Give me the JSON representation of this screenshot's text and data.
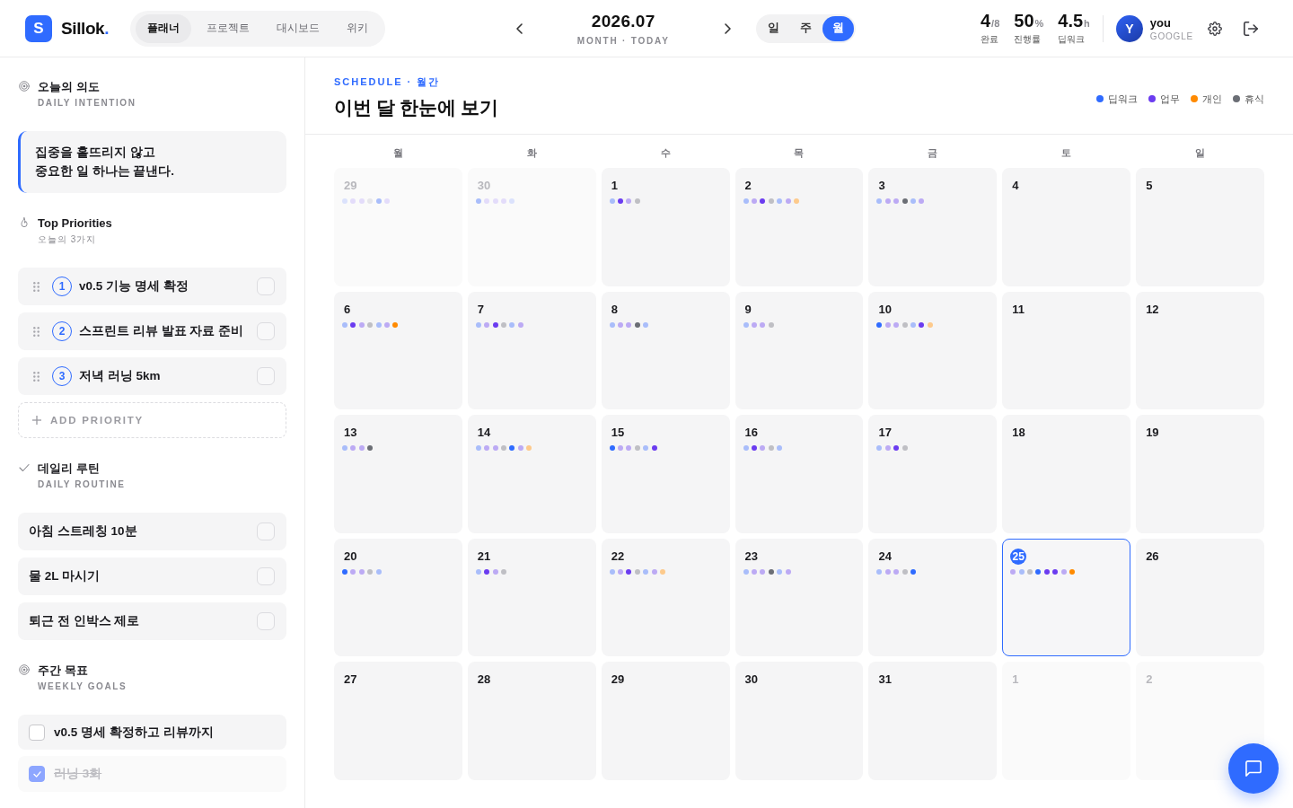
{
  "header": {
    "logo": {
      "letter": "S",
      "name": "Sillok",
      "suffix": "."
    },
    "nav_tabs": [
      {
        "label": "플래너",
        "selected": true
      },
      {
        "label": "프로젝트",
        "selected": false
      },
      {
        "label": "대시보드",
        "selected": false
      },
      {
        "label": "위키",
        "selected": false
      }
    ],
    "period": {
      "title": "2026.07",
      "subtitle": "MONTH · TODAY"
    },
    "view_modes": [
      {
        "label": "일",
        "selected": false
      },
      {
        "label": "주",
        "selected": false
      },
      {
        "label": "월",
        "selected": true
      }
    ],
    "stats": [
      {
        "value": "4",
        "unit": "/8",
        "label": "완료"
      },
      {
        "value": "50",
        "unit": "%",
        "label": "진행률"
      },
      {
        "value": "4.5",
        "unit": "h",
        "label": "딥워크"
      }
    ],
    "user": {
      "initial": "Y",
      "name": "you",
      "provider": "GOOGLE"
    }
  },
  "sidebar": {
    "intention": {
      "title": "오늘의 의도",
      "subtitle": "DAILY INTENTION",
      "text": "집중을 흩뜨리지 않고\n중요한 일 하나는 끝낸다."
    },
    "priorities": {
      "title": "Top Priorities",
      "subtitle": "오늘의 3가지",
      "items": [
        {
          "number": "1",
          "label": "v0.5 기능 명세 확정",
          "checked": false
        },
        {
          "number": "2",
          "label": "스프린트 리뷰 발표 자료 준비",
          "checked": false
        },
        {
          "number": "3",
          "label": "저녁 러닝 5km",
          "checked": false
        }
      ],
      "add_label": "ADD PRIORITY"
    },
    "routine": {
      "title": "데일리 루틴",
      "subtitle": "DAILY ROUTINE",
      "items": [
        {
          "label": "아침 스트레칭 10분",
          "checked": false
        },
        {
          "label": "물 2L 마시기",
          "checked": false
        },
        {
          "label": "퇴근 전 인박스 제로",
          "checked": false
        }
      ]
    },
    "weekly_goals": {
      "title": "주간 목표",
      "subtitle": "WEEKLY GOALS",
      "items": [
        {
          "label": "v0.5 명세 확정하고 리뷰까지",
          "checked": false
        },
        {
          "label": "러닝 3회",
          "checked": true
        }
      ]
    }
  },
  "main": {
    "eyebrow": "SCHEDULE · 월간",
    "title": "이번 달 한눈에 보기",
    "legend": [
      {
        "label": "딥워크",
        "color": "#2f6bff"
      },
      {
        "label": "업무",
        "color": "#6b3cf0"
      },
      {
        "label": "개인",
        "color": "#ff8a00"
      },
      {
        "label": "휴식",
        "color": "#6b6e75"
      }
    ],
    "calendar": {
      "weekdays": [
        "월",
        "화",
        "수",
        "목",
        "금",
        "토",
        "일"
      ],
      "weeks": [
        [
          {
            "date": "29",
            "outside_month": true,
            "today": false,
            "dots": [
              {
                "color": "#dbe2fc"
              },
              {
                "color": "#e3dcfa"
              },
              {
                "color": "#e3dcfa"
              },
              {
                "color": "#e6e6ea"
              },
              {
                "color": "#a9bdfa"
              },
              {
                "color": "#e3dcfa"
              }
            ]
          },
          {
            "date": "30",
            "outside_month": true,
            "today": false,
            "dots": [
              {
                "color": "#a9bdfa"
              },
              {
                "color": "#e3dcfa"
              },
              {
                "color": "#e3dcfa"
              },
              {
                "color": "#e3dcfa"
              },
              {
                "color": "#dbe2fc"
              }
            ]
          },
          {
            "date": "1",
            "outside_month": false,
            "today": false,
            "dots": [
              {
                "color": "#a9bdfa"
              },
              {
                "color": "#6b3cf0"
              },
              {
                "color": "#bcaaf4"
              },
              {
                "color": "#bfbfc4"
              }
            ]
          },
          {
            "date": "2",
            "outside_month": false,
            "today": false,
            "dots": [
              {
                "color": "#a9bdfa"
              },
              {
                "color": "#bcaaf4"
              },
              {
                "color": "#6b3cf0"
              },
              {
                "color": "#bfbfc4"
              },
              {
                "color": "#a9bdfa"
              },
              {
                "color": "#bcaaf4"
              },
              {
                "color": "#fdca8c"
              }
            ]
          },
          {
            "date": "3",
            "outside_month": false,
            "today": false,
            "dots": [
              {
                "color": "#a9bdfa"
              },
              {
                "color": "#bcaaf4"
              },
              {
                "color": "#bcaaf4"
              },
              {
                "color": "#6b6e75"
              },
              {
                "color": "#a9bdfa"
              },
              {
                "color": "#bcaaf4"
              }
            ]
          },
          {
            "date": "4",
            "outside_month": false,
            "today": false
          },
          {
            "date": "5",
            "outside_month": false,
            "today": false
          }
        ],
        [
          {
            "date": "6",
            "outside_month": false,
            "today": false,
            "dots": [
              {
                "color": "#a9bdfa"
              },
              {
                "color": "#6b3cf0"
              },
              {
                "color": "#bcaaf4"
              },
              {
                "color": "#bfbfc4"
              },
              {
                "color": "#a9bdfa"
              },
              {
                "color": "#bcaaf4"
              },
              {
                "color": "#ff8a00"
              }
            ]
          },
          {
            "date": "7",
            "outside_month": false,
            "today": false,
            "dots": [
              {
                "color": "#a9bdfa"
              },
              {
                "color": "#bcaaf4"
              },
              {
                "color": "#6b3cf0"
              },
              {
                "color": "#bfbfc4"
              },
              {
                "color": "#a9bdfa"
              },
              {
                "color": "#bcaaf4"
              }
            ]
          },
          {
            "date": "8",
            "outside_month": false,
            "today": false,
            "dots": [
              {
                "color": "#a9bdfa"
              },
              {
                "color": "#bcaaf4"
              },
              {
                "color": "#bcaaf4"
              },
              {
                "color": "#6b6e75"
              },
              {
                "color": "#a9bdfa"
              }
            ]
          },
          {
            "date": "9",
            "outside_month": false,
            "today": false,
            "dots": [
              {
                "color": "#a9bdfa"
              },
              {
                "color": "#bcaaf4"
              },
              {
                "color": "#bcaaf4"
              },
              {
                "color": "#bfbfc4"
              }
            ]
          },
          {
            "date": "10",
            "outside_month": false,
            "today": false,
            "dots": [
              {
                "color": "#2f6bff"
              },
              {
                "color": "#bcaaf4"
              },
              {
                "color": "#bcaaf4"
              },
              {
                "color": "#bfbfc4"
              },
              {
                "color": "#a9bdfa"
              },
              {
                "color": "#6b3cf0"
              },
              {
                "color": "#fdca8c"
              }
            ]
          },
          {
            "date": "11",
            "outside_month": false,
            "today": false
          },
          {
            "date": "12",
            "outside_month": false,
            "today": false
          }
        ],
        [
          {
            "date": "13",
            "outside_month": false,
            "today": false,
            "dots": [
              {
                "color": "#a9bdfa"
              },
              {
                "color": "#bcaaf4"
              },
              {
                "color": "#bcaaf4"
              },
              {
                "color": "#6b6e75"
              }
            ]
          },
          {
            "date": "14",
            "outside_month": false,
            "today": false,
            "dots": [
              {
                "color": "#a9bdfa"
              },
              {
                "color": "#bcaaf4"
              },
              {
                "color": "#bcaaf4"
              },
              {
                "color": "#bfbfc4"
              },
              {
                "color": "#2f6bff"
              },
              {
                "color": "#bcaaf4"
              },
              {
                "color": "#fdca8c"
              }
            ]
          },
          {
            "date": "15",
            "outside_month": false,
            "today": false,
            "dots": [
              {
                "color": "#2f6bff"
              },
              {
                "color": "#bcaaf4"
              },
              {
                "color": "#bcaaf4"
              },
              {
                "color": "#bfbfc4"
              },
              {
                "color": "#a9bdfa"
              },
              {
                "color": "#6b3cf0"
              }
            ]
          },
          {
            "date": "16",
            "outside_month": false,
            "today": false,
            "dots": [
              {
                "color": "#a9bdfa"
              },
              {
                "color": "#6b3cf0"
              },
              {
                "color": "#bcaaf4"
              },
              {
                "color": "#bfbfc4"
              },
              {
                "color": "#a9bdfa"
              }
            ]
          },
          {
            "date": "17",
            "outside_month": false,
            "today": false,
            "dots": [
              {
                "color": "#a9bdfa"
              },
              {
                "color": "#bcaaf4"
              },
              {
                "color": "#6b3cf0"
              },
              {
                "color": "#bfbfc4"
              }
            ]
          },
          {
            "date": "18",
            "outside_month": false,
            "today": false
          },
          {
            "date": "19",
            "outside_month": false,
            "today": false
          }
        ],
        [
          {
            "date": "20",
            "outside_month": false,
            "today": false,
            "dots": [
              {
                "color": "#2f6bff"
              },
              {
                "color": "#bcaaf4"
              },
              {
                "color": "#bcaaf4"
              },
              {
                "color": "#bfbfc4"
              },
              {
                "color": "#a9bdfa"
              }
            ]
          },
          {
            "date": "21",
            "outside_month": false,
            "today": false,
            "dots": [
              {
                "color": "#a9bdfa"
              },
              {
                "color": "#6b3cf0"
              },
              {
                "color": "#bcaaf4"
              },
              {
                "color": "#bfbfc4"
              }
            ]
          },
          {
            "date": "22",
            "outside_month": false,
            "today": false,
            "dots": [
              {
                "color": "#a9bdfa"
              },
              {
                "color": "#bcaaf4"
              },
              {
                "color": "#6b3cf0"
              },
              {
                "color": "#bfbfc4"
              },
              {
                "color": "#a9bdfa"
              },
              {
                "color": "#bcaaf4"
              },
              {
                "color": "#fdca8c"
              }
            ]
          },
          {
            "date": "23",
            "outside_month": false,
            "today": false,
            "dots": [
              {
                "color": "#a9bdfa"
              },
              {
                "color": "#bcaaf4"
              },
              {
                "color": "#bcaaf4"
              },
              {
                "color": "#6b6e75"
              },
              {
                "color": "#a9bdfa"
              },
              {
                "color": "#bcaaf4"
              }
            ]
          },
          {
            "date": "24",
            "outside_month": false,
            "today": false,
            "dots": [
              {
                "color": "#a9bdfa"
              },
              {
                "color": "#bcaaf4"
              },
              {
                "color": "#bcaaf4"
              },
              {
                "color": "#bfbfc4"
              },
              {
                "color": "#2f6bff"
              }
            ]
          },
          {
            "date": "25",
            "outside_month": false,
            "today": true,
            "dots": [
              {
                "color": "#bcaaf4"
              },
              {
                "color": "#a9bdfa"
              },
              {
                "color": "#bfbfc4"
              },
              {
                "color": "#2f6bff"
              },
              {
                "color": "#6b3cf0"
              },
              {
                "color": "#6b3cf0"
              },
              {
                "color": "#bcaaf4"
              },
              {
                "color": "#ff8a00"
              }
            ]
          },
          {
            "date": "26",
            "outside_month": false,
            "today": false
          }
        ],
        [
          {
            "date": "27",
            "outside_month": false,
            "today": false
          },
          {
            "date": "28",
            "outside_month": false,
            "today": false
          },
          {
            "date": "29",
            "outside_month": false,
            "today": false
          },
          {
            "date": "30",
            "outside_month": false,
            "today": false
          },
          {
            "date": "31",
            "outside_month": false,
            "today": false
          },
          {
            "date": "1",
            "outside_month": true,
            "today": false
          },
          {
            "date": "2",
            "outside_month": true,
            "today": false
          }
        ]
      ]
    }
  }
}
